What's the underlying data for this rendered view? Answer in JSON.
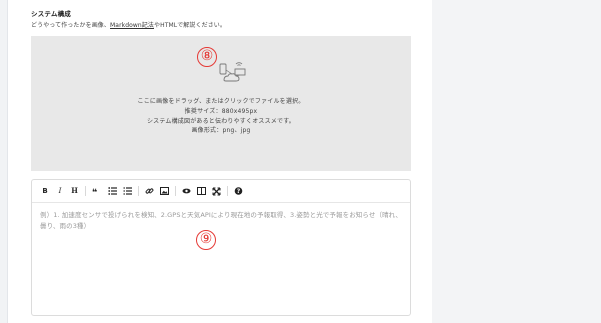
{
  "section": {
    "title": "システム構成",
    "desc_before": "どうやって作ったかを画像、",
    "desc_link": "Markdown記法",
    "desc_after": "やHTMLで解説ください。"
  },
  "dropzone": {
    "line1": "ここに画像をドラッグ、またはクリックでファイルを選択。",
    "line2": "推奨サイズ：880x495px",
    "line3": "システム構成図があると伝わりやすくオススメです。",
    "line4": "画像形式：png、jpg"
  },
  "badges": {
    "eight": "⑧",
    "nine": "⑨"
  },
  "editor": {
    "placeholder": "例）1. 加速度センサで投げられを検知、2.GPSと天気APIにより現在地の予報取得、3.姿勢と光で予報をお知らせ（晴れ、曇り、雨の3種）",
    "toolbar": {
      "bold": "B",
      "italic": "I",
      "heading": "H"
    }
  },
  "icons": [
    "bold-icon",
    "italic-icon",
    "heading-icon",
    "quote-icon",
    "unordered-list-icon",
    "ordered-list-icon",
    "link-icon",
    "image-icon",
    "preview-icon",
    "side-by-side-icon",
    "fullscreen-icon",
    "help-icon",
    "upload-device-icon"
  ],
  "colors": {
    "badge": "#e53935",
    "dropzone_bg": "#e8e8e8",
    "right_panel_bg": "#f3f4f6"
  }
}
